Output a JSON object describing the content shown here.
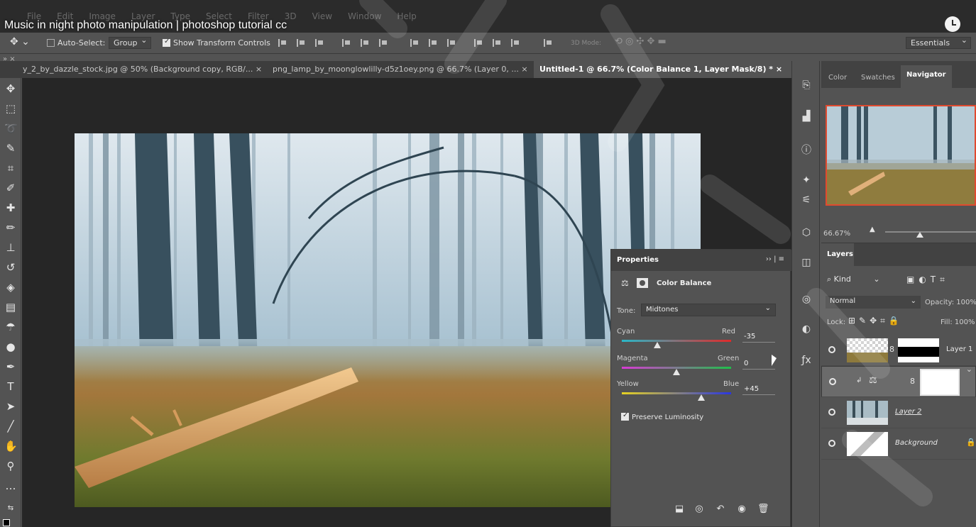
{
  "video_title": "Music in night photo manipulation | photoshop tutorial cc",
  "menu": [
    "File",
    "Edit",
    "Image",
    "Layer",
    "Type",
    "Select",
    "Filter",
    "3D",
    "View",
    "Window",
    "Help"
  ],
  "options": {
    "auto_select_label": "Auto-Select:",
    "auto_select_checked": false,
    "auto_select_mode": "Group",
    "show_transform_label": "Show Transform Controls",
    "show_transform_checked": true,
    "mode_3d_label": "3D Mode:",
    "workspace": "Essentials"
  },
  "tabs": [
    {
      "label": "y_2_by_dazzle_stock.jpg @ 50% (Background copy, RGB/...",
      "close": "×",
      "active": false
    },
    {
      "label": "png_lamp_by_moonglowlilly-d5z1oey.png @ 66.7% (Layer 0, ...",
      "close": "×",
      "active": false
    },
    {
      "label": "Untitled-1 @ 66.7% (Color Balance 1, Layer Mask/8) *",
      "close": "×",
      "active": true
    }
  ],
  "navigator": {
    "tabs": [
      "Color",
      "Swatches",
      "Navigator"
    ],
    "active_tab": "Navigator",
    "zoom": "66.67%"
  },
  "properties": {
    "title": "Properties",
    "adjustment": "Color Balance",
    "tone_label": "Tone:",
    "tone_value": "Midtones",
    "sliders": [
      {
        "left": "Cyan",
        "right": "Red",
        "value": "-35",
        "level": -35,
        "left_color": "#29b7c8",
        "right_color": "#e02a2a"
      },
      {
        "left": "Magenta",
        "right": "Green",
        "value": "0",
        "level": 0,
        "left_color": "#d83ad4",
        "right_color": "#1fbf4a"
      },
      {
        "left": "Yellow",
        "right": "Blue",
        "value": "+45",
        "level": 45,
        "left_color": "#e6d222",
        "right_color": "#2a36e0"
      }
    ],
    "preserve_luminosity_label": "Preserve Luminosity",
    "preserve_luminosity_checked": true
  },
  "layers": {
    "tab": "Layers",
    "filter_kind": "Kind",
    "blend_mode": "Normal",
    "opacity_label": "Opacity:",
    "opacity_value": "100%",
    "lock_label": "Lock:",
    "fill_label": "Fill:",
    "fill_value": "100%",
    "items": [
      {
        "name": "Layer 1",
        "kind": "pixel-with-mask"
      },
      {
        "name": "",
        "kind": "color-balance-adjustment",
        "selected": true
      },
      {
        "name": "Layer 2",
        "kind": "pixel"
      },
      {
        "name": "Background",
        "kind": "background-locked"
      }
    ]
  },
  "colors": {
    "app_dark": "#2b2b2b",
    "panel": "#535353",
    "canvas_bg": "#262626",
    "navigator_frame": "#e04a2f"
  }
}
